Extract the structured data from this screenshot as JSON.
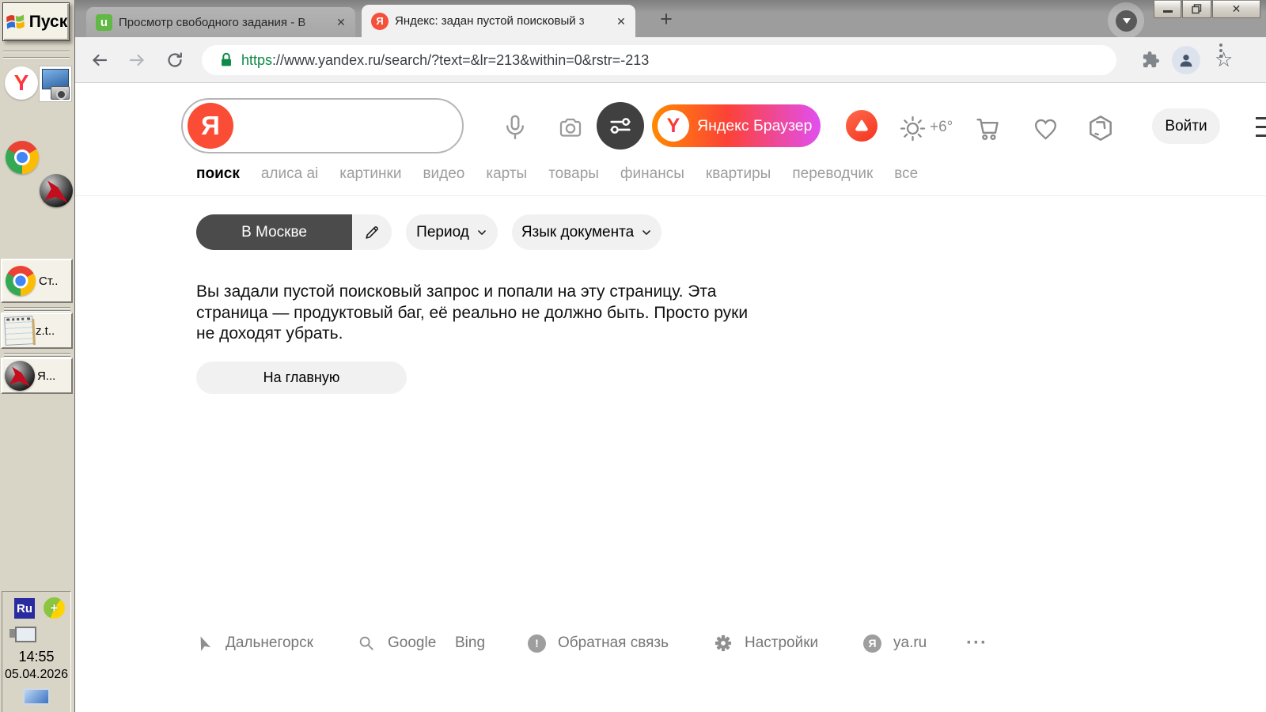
{
  "desktop": {
    "start_label": "Пуск",
    "ya_icon_letter": "Y",
    "taskbar_items": [
      {
        "label": "Ст.."
      },
      {
        "label": "z.t.."
      },
      {
        "label": "Я..."
      }
    ],
    "tray": {
      "language": "Ru",
      "time": "14:55",
      "date": "05.04.2026"
    }
  },
  "browser": {
    "tabs": [
      {
        "icon_letter": "u",
        "title": "Просмотр свободного задания - B"
      },
      {
        "icon_letter": "Я",
        "title": "Яндекс: задан пустой поисковый з"
      }
    ],
    "url": {
      "scheme": "https",
      "rest": "://www.yandex.ru/search/?text=&lr=213&within=0&rstr=-213"
    }
  },
  "page": {
    "logo_letter": "Я",
    "search_value": "",
    "promo": {
      "letter": "Y",
      "label": "Яндекс Браузер"
    },
    "weather_temp": "+6°",
    "login_label": "Войти",
    "nav": [
      "поиск",
      "алиса ai",
      "картинки",
      "видео",
      "карты",
      "товары",
      "финансы",
      "квартиры",
      "переводчик",
      "все"
    ],
    "filters": {
      "location": "В Москве",
      "period": "Период",
      "doc_language": "Язык документа"
    },
    "message_lines": [
      "Вы задали пустой поисковый запрос и попали на эту страницу. Эта",
      "страница — продуктовый баг, её реально не должно быть. Просто руки",
      "не доходят убрать."
    ],
    "home_label": "На главную",
    "footer": {
      "city": "Дальнегорск",
      "google": "Google",
      "bing": "Bing",
      "feedback": "Обратная связь",
      "feedback_icon": "!",
      "settings": "Настройки",
      "ya_letter": "Я",
      "yaru": "ya.ru",
      "more": "···"
    }
  },
  "colors": {
    "yandex_red": "#fb4d35",
    "promo_gradient_start": "#ff8a00",
    "promo_gradient_mid": "#fc4238",
    "promo_gradient_end": "#e14ff0",
    "favicon_green": "#5fb944",
    "url_green": "#0e8a45"
  }
}
